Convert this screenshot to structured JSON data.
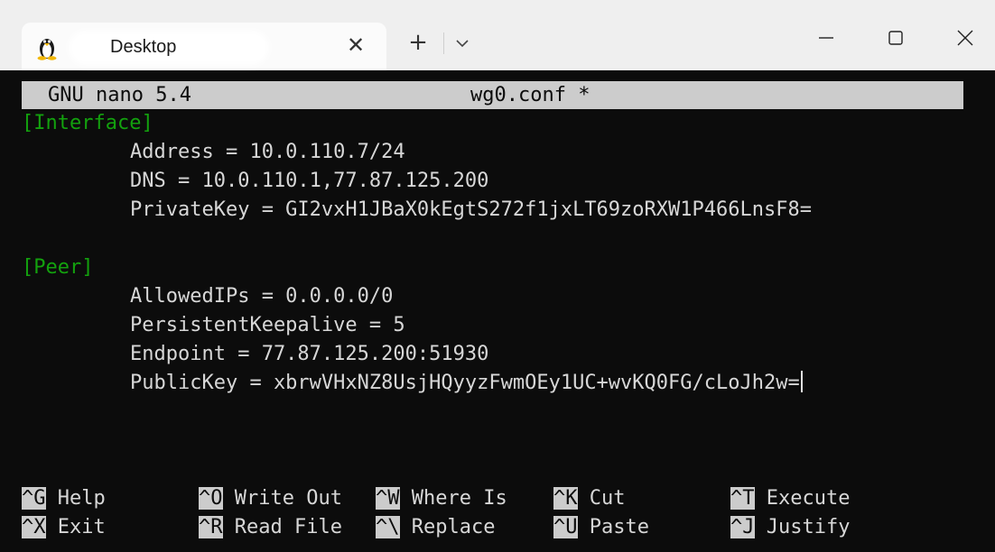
{
  "titlebar": {
    "tab_title": "Desktop",
    "tab_icon": "linux-penguin-icon",
    "close_label": "✕",
    "new_tab_label": "+"
  },
  "editor": {
    "app_name": "GNU nano 5.4",
    "file_name": "wg0.conf *",
    "lines": {
      "interface_header": "[Interface]",
      "address": "Address = 10.0.110.7/24",
      "dns": "DNS = 10.0.110.1,77.87.125.200",
      "private_key": "PrivateKey = GI2vxH1JBaX0kEgtS272f1jxLT69zoRXW1P466LnsF8=",
      "peer_header": "[Peer]",
      "allowed_ips": "AllowedIPs = 0.0.0.0/0",
      "keepalive": "PersistentKeepalive = 5",
      "endpoint": "Endpoint = 77.87.125.200:51930",
      "public_key": "PublicKey = xbrwVHxNZ8UsjHQyyzFwmOEy1UC+wvKQ0FG/cLoJh2w="
    }
  },
  "shortcuts": [
    {
      "key": "^G",
      "label": "Help"
    },
    {
      "key": "^O",
      "label": "Write Out"
    },
    {
      "key": "^W",
      "label": "Where Is"
    },
    {
      "key": "^K",
      "label": "Cut"
    },
    {
      "key": "^T",
      "label": "Execute"
    },
    {
      "key": "^X",
      "label": "Exit"
    },
    {
      "key": "^R",
      "label": "Read File"
    },
    {
      "key": "^\\",
      "label": "Replace"
    },
    {
      "key": "^U",
      "label": "Paste"
    },
    {
      "key": "^J",
      "label": "Justify"
    }
  ],
  "colors": {
    "terminal_bg": "#0c0c0c",
    "text": "#d7d7d7",
    "section_green": "#13a10e",
    "header_bar": "#cccccc"
  }
}
